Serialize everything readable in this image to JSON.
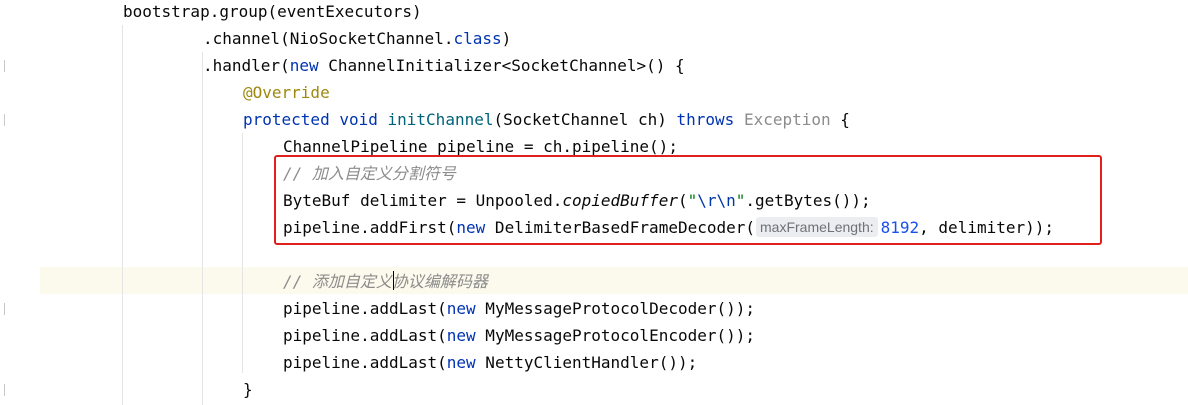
{
  "editor": {
    "lines": {
      "l1": {
        "text": "bootstrap.group(eventExecutors)"
      },
      "l2": {
        "lead": ".channel(NioSocketChannel.",
        "cls": "class",
        "tail": ")"
      },
      "l3": {
        "lead": ".handler(",
        "kw": "new",
        "tail": " ChannelInitializer<SocketChannel>() {"
      },
      "l4": {
        "annotation": "@Override"
      },
      "l5": {
        "kw1": "protected",
        "kw2": "void",
        "method": "initChannel",
        "params": "(SocketChannel ch) ",
        "throws": "throws",
        "exception": "Exception",
        "brace": " {"
      },
      "l6": {
        "text": "ChannelPipeline pipeline = ch.pipeline();"
      },
      "l7": {
        "comment": "// 加入自定义分割符号"
      },
      "l8": {
        "lead": "ByteBuf delimiter = Unpooled.",
        "call": "copiedBuffer",
        "open": "(",
        "q1": "\"",
        "esc1": "\\r",
        "esc2": "\\n",
        "q2": "\"",
        "tail": ".getBytes());"
      },
      "l9": {
        "lead": "pipeline.addFirst(",
        "kw": "new",
        "mid": " DelimiterBasedFrameDecoder(",
        "hint": "maxFrameLength:",
        "num": "8192",
        "tail": ", delimiter));"
      },
      "l10": {
        "comment": "// 添加自定义协议编解码器"
      },
      "l11": {
        "lead": "pipeline.addLast(",
        "kw": "new",
        "tail": " MyMessageProtocolDecoder());"
      },
      "l12": {
        "lead": "pipeline.addLast(",
        "kw": "new",
        "tail": " MyMessageProtocolEncoder());"
      },
      "l13": {
        "lead": "pipeline.addLast(",
        "kw": "new",
        "tail": " NettyClientHandler());"
      },
      "l14": {
        "text": "}"
      }
    }
  },
  "colors": {
    "keyword": "#0033b3",
    "annotation": "#9e880d",
    "comment": "#8c8c8c",
    "string": "#067d17",
    "number": "#1750eb",
    "highlight_border": "#e0201c",
    "caret_line": "#fcfaed"
  }
}
